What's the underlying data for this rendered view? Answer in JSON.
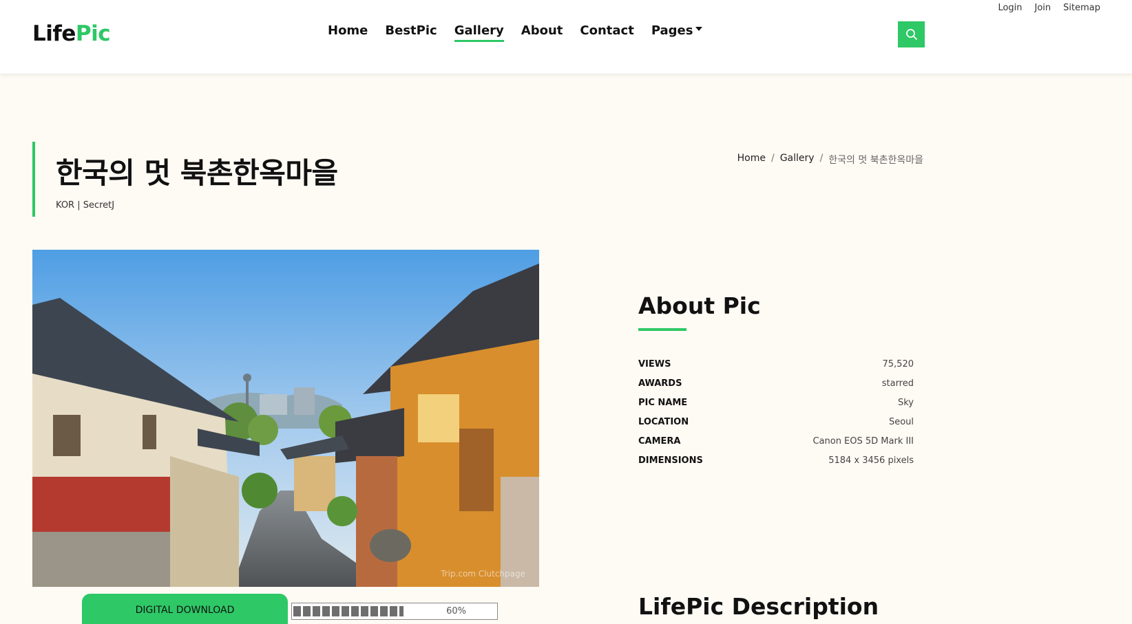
{
  "brand": {
    "part1": "Life",
    "part2": "Pic",
    "accent": "#2ec866"
  },
  "nav": {
    "items": [
      {
        "label": "Home"
      },
      {
        "label": "BestPic"
      },
      {
        "label": "Gallery",
        "active": true
      },
      {
        "label": "About"
      },
      {
        "label": "Contact"
      },
      {
        "label": "Pages",
        "dropdown": true
      }
    ],
    "search_icon": "search-icon"
  },
  "toplinks": {
    "login": "Login",
    "join": "Join",
    "sitemap": "Sitemap"
  },
  "page": {
    "title": "한국의 멋 북촌한옥마을",
    "subtitle": "KOR | SecretJ"
  },
  "breadcrumb": {
    "home": "Home",
    "gallery": "Gallery",
    "current": "한국의 멋 북촌한옥마을",
    "separator": "/"
  },
  "photo": {
    "watermark": "Trip.com Clutchpage"
  },
  "download": {
    "label": "DIGITAL DOWNLOAD",
    "progress_label": "60%",
    "progress": 0.6
  },
  "about": {
    "title": "About Pic",
    "rows": [
      {
        "label": "VIEWS",
        "value": "75,520"
      },
      {
        "label": "AWARDS",
        "value": "starred"
      },
      {
        "label": "PIC NAME",
        "value": "Sky"
      },
      {
        "label": "LOCATION",
        "value": "Seoul"
      },
      {
        "label": "CAMERA",
        "value": "Canon EOS 5D Mark III"
      },
      {
        "label": "DIMENSIONS",
        "value": "5184 x 3456 pixels"
      }
    ]
  },
  "description": {
    "title": "LifePic Description"
  }
}
